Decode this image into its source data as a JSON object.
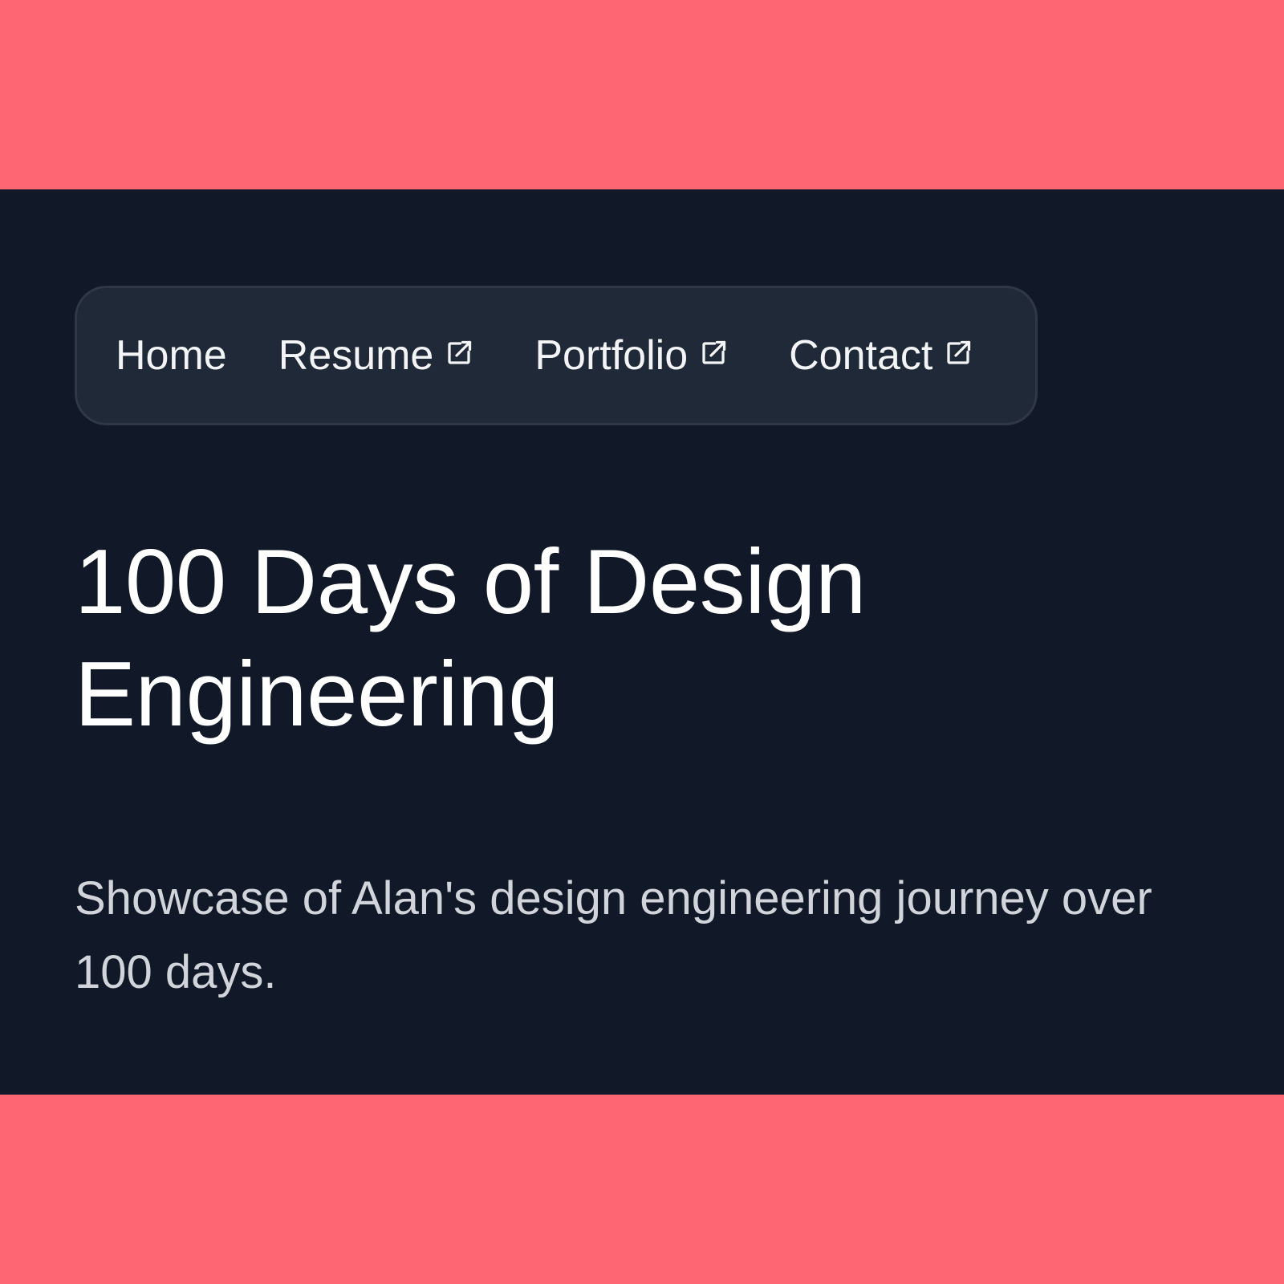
{
  "colors": {
    "frame_background": "#ff6673",
    "page_background": "#111827",
    "nav_background": "#1f2937",
    "nav_border": "#2e3846",
    "heading_text": "#ffffff",
    "body_text": "#d1d5db"
  },
  "nav": {
    "items": [
      {
        "label": "Home",
        "external": false
      },
      {
        "label": "Resume",
        "external": true,
        "icon": "external-link-icon"
      },
      {
        "label": "Portfolio",
        "external": true,
        "icon": "external-link-icon"
      },
      {
        "label": "Contact",
        "external": true,
        "icon": "external-link-icon"
      }
    ]
  },
  "hero": {
    "title": "100 Days of Design Engineering",
    "subtitle": "Showcase of Alan's design engineering journey over 100 days."
  }
}
